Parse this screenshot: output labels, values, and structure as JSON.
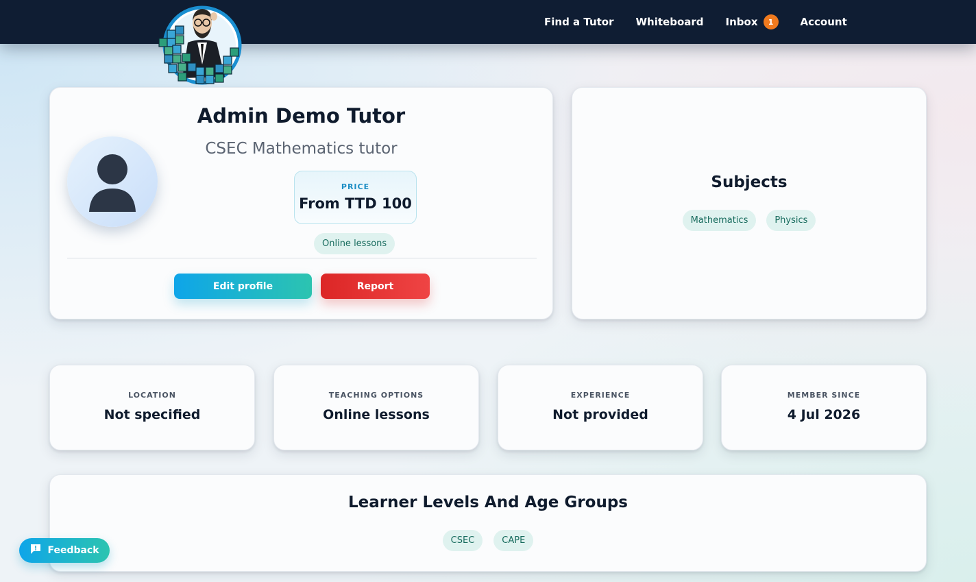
{
  "nav": {
    "links": [
      {
        "label": "Find a Tutor"
      },
      {
        "label": "Whiteboard"
      },
      {
        "label": "Inbox",
        "badge": "1"
      },
      {
        "label": "Account"
      }
    ]
  },
  "profile": {
    "name": "Admin Demo Tutor",
    "headline": "CSEC Mathematics tutor",
    "price_label": "PRICE",
    "price_value": "From TTD 100",
    "lesson_mode": "Online lessons",
    "edit_label": "Edit profile",
    "report_label": "Report"
  },
  "subjects": {
    "title": "Subjects",
    "items": [
      "Mathematics",
      "Physics"
    ]
  },
  "info": [
    {
      "label": "LOCATION",
      "value": "Not specified"
    },
    {
      "label": "TEACHING OPTIONS",
      "value": "Online lessons"
    },
    {
      "label": "EXPERIENCE",
      "value": "Not provided"
    },
    {
      "label": "MEMBER SINCE",
      "value": "4 Jul 2026"
    }
  ],
  "levels": {
    "title": "Learner Levels And Age Groups",
    "items": [
      "CSEC",
      "CAPE"
    ]
  },
  "feedback": {
    "label": "Feedback"
  },
  "colors": {
    "navbar": "#0f1d33",
    "badge": "#f07a1e",
    "primary_gradient_start": "#0ea5e9",
    "primary_gradient_end": "#2cc4b0",
    "danger": "#dc2626",
    "pill_bg": "#dff2ef",
    "pill_text": "#176b5d"
  },
  "icons": {
    "logo": "tutor-mascot-logo",
    "avatar": "user-silhouette-icon",
    "feedback": "chat-feedback-icon"
  }
}
